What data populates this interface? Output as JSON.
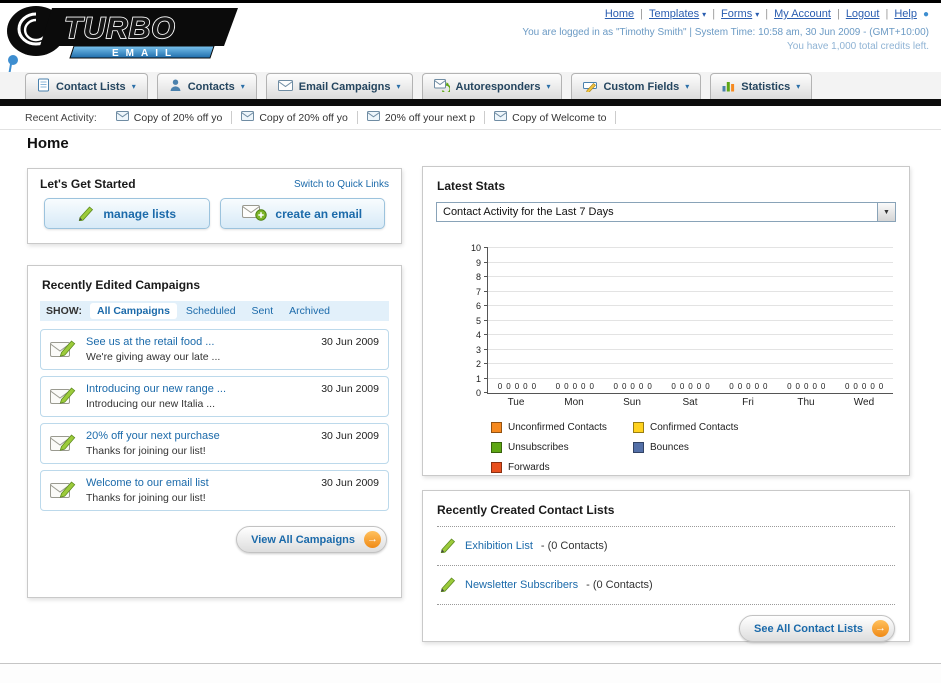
{
  "colors": {
    "link_blue": "#1b6aaa",
    "accent_orange": "#f28a16",
    "nav_bar_black": "#0c0c0c"
  },
  "header": {
    "logo_title": "TURBO",
    "logo_subtitle": "EMAIL",
    "nav_links": [
      {
        "label": "Home",
        "dropdown": false
      },
      {
        "label": "Templates",
        "dropdown": true
      },
      {
        "label": "Forms",
        "dropdown": true
      },
      {
        "label": "My Account",
        "dropdown": false
      },
      {
        "label": "Logout",
        "dropdown": false
      },
      {
        "label": "Help",
        "dropdown": false
      }
    ],
    "session_line": "You are logged in as \"Timothy Smith\" | System Time: 10:58 am, 30 Jun 2009 - (GMT+10:00)",
    "credits_line": "You have 1,000 total credits left."
  },
  "nav_tabs": [
    {
      "label": "Contact Lists",
      "icon": "list"
    },
    {
      "label": "Contacts",
      "icon": "person"
    },
    {
      "label": "Email Campaigns",
      "icon": "envelope"
    },
    {
      "label": "Autoresponders",
      "icon": "autoresponder"
    },
    {
      "label": "Custom Fields",
      "icon": "field"
    },
    {
      "label": "Statistics",
      "icon": "stats"
    }
  ],
  "recent_activity": {
    "label": "Recent Activity:",
    "items": [
      "Copy of 20% off yo",
      "Copy of 20% off yo",
      "20% off your next p",
      "Copy of Welcome to"
    ]
  },
  "page_title": "Home",
  "get_started": {
    "title": "Let's Get Started",
    "switch_link": "Switch to Quick Links",
    "buttons": [
      {
        "label": "manage lists",
        "icon": "pencil"
      },
      {
        "label": "create an email",
        "icon": "envelope_plus"
      }
    ]
  },
  "campaigns": {
    "title": "Recently Edited Campaigns",
    "show_label": "SHOW:",
    "filters": [
      "All Campaigns",
      "Scheduled",
      "Sent",
      "Archived"
    ],
    "selected_filter": "All Campaigns",
    "items": [
      {
        "title": "See us at the retail food ...",
        "subtitle": "We're giving away our late ...",
        "date": "30 Jun 2009"
      },
      {
        "title": "Introducing our new range ...",
        "subtitle": "Introducing our new Italia ...",
        "date": "30 Jun 2009"
      },
      {
        "title": "20% off your next purchase",
        "subtitle": "Thanks for joining our list!",
        "date": "30 Jun 2009"
      },
      {
        "title": "Welcome to our email list",
        "subtitle": "Thanks for joining our list!",
        "date": "30 Jun 2009"
      }
    ],
    "view_all_label": "View All Campaigns"
  },
  "stats": {
    "title": "Latest Stats",
    "dropdown_value": "Contact Activity for the Last 7 Days",
    "chart_data": {
      "type": "bar",
      "title": "Contact Activity for the Last 7 Days",
      "categories": [
        "Tue",
        "Mon",
        "Sun",
        "Sat",
        "Fri",
        "Thu",
        "Wed"
      ],
      "series": [
        {
          "name": "Unconfirmed Contacts",
          "color": "#f6891f",
          "values": [
            0,
            0,
            0,
            0,
            0,
            0,
            0
          ]
        },
        {
          "name": "Confirmed Contacts",
          "color": "#ffd21f",
          "values": [
            0,
            0,
            0,
            0,
            0,
            0,
            0
          ]
        },
        {
          "name": "Unsubscribes",
          "color": "#5ea614",
          "values": [
            0,
            0,
            0,
            0,
            0,
            0,
            0
          ]
        },
        {
          "name": "Bounces",
          "color": "#5470a8",
          "values": [
            0,
            0,
            0,
            0,
            0,
            0,
            0
          ]
        },
        {
          "name": "Forwards",
          "color": "#e8501f",
          "values": [
            0,
            0,
            0,
            0,
            0,
            0,
            0
          ]
        }
      ],
      "xlabel": "",
      "ylabel": "",
      "ylim": [
        0,
        10
      ],
      "yticks": [
        0,
        1,
        2,
        3,
        4,
        5,
        6,
        7,
        8,
        9,
        10
      ],
      "grid": true,
      "legend_position": "bottom",
      "value_labels_shown": true
    }
  },
  "contact_lists": {
    "title": "Recently Created Contact Lists",
    "items": [
      {
        "name": "Exhibition List",
        "suffix": "- (0 Contacts)"
      },
      {
        "name": "Newsletter Subscribers",
        "suffix": "- (0 Contacts)"
      }
    ],
    "see_all_label": "See All Contact Lists"
  }
}
